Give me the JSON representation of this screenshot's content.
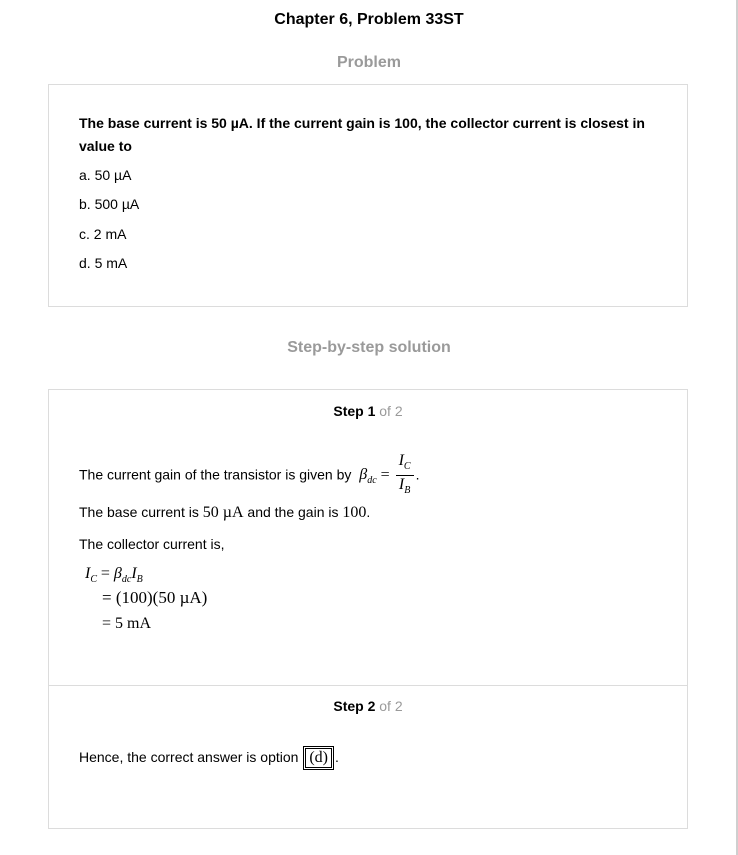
{
  "header": {
    "title": "Chapter 6, Problem 33ST"
  },
  "problem": {
    "heading": "Problem",
    "question": "The base current is 50 µA. If the current gain is 100, the collector current is closest in value to",
    "options": [
      "a. 50 µA",
      "b. 500 µA",
      "c. 2 mA",
      "d. 5 mA"
    ]
  },
  "solution": {
    "heading": "Step-by-step solution",
    "steps": [
      {
        "label": "Step 1",
        "of": "of 2",
        "intro": "The current gain of the transistor is given by",
        "base_prefix": "The base current is",
        "base_value": "50 µA",
        "base_mid": "and the gain is",
        "gain_value": "100",
        "collector_intro": "The collector current is,",
        "eq1": "= (100)(50 µA)",
        "eq2": "= 5 mA"
      },
      {
        "label": "Step 2",
        "of": "of 2",
        "answer_prefix": "Hence, the correct answer is option",
        "answer_option": "(d)"
      }
    ]
  }
}
